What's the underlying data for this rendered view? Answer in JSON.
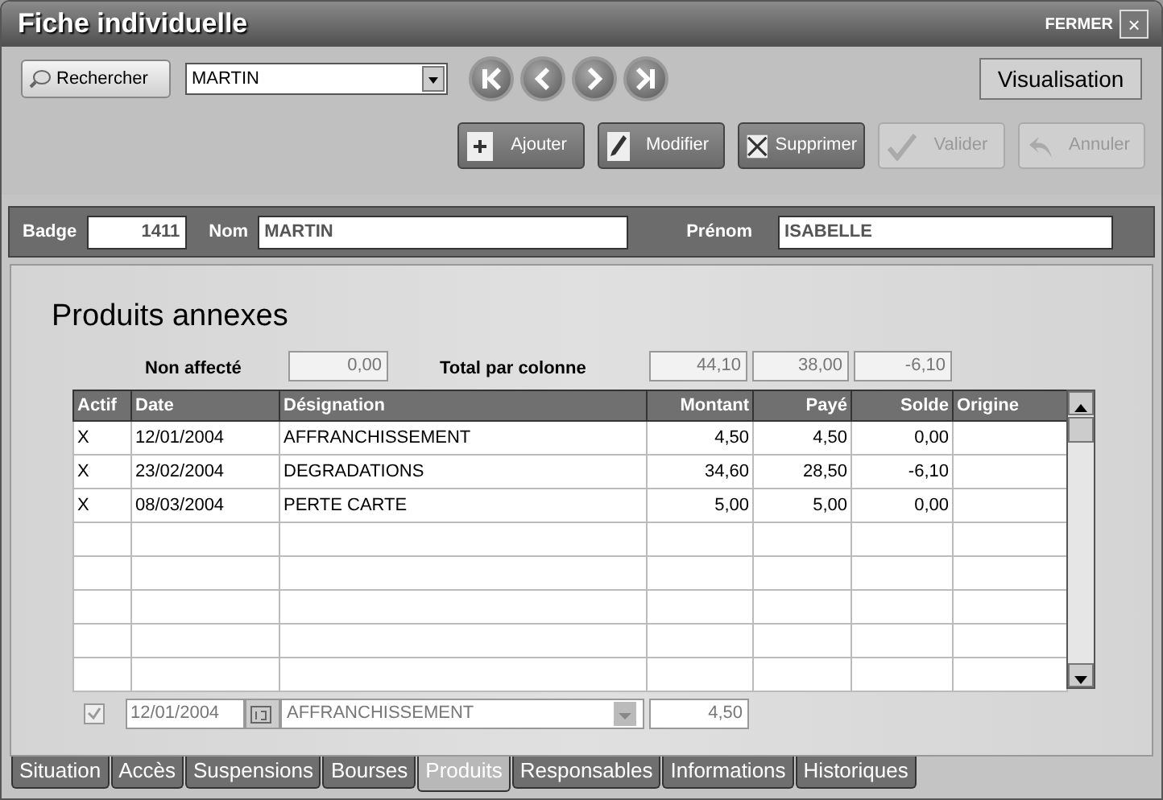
{
  "window": {
    "title": "Fiche individuelle",
    "close_label": "FERMER",
    "close_glyph": "×"
  },
  "toolbar": {
    "search_button": "Rechercher",
    "search_value": "MARTIN",
    "mode": "Visualisation",
    "actions": [
      {
        "label": "Ajouter",
        "kind": "add",
        "disabled": false
      },
      {
        "label": "Modifier",
        "kind": "edit",
        "disabled": false
      },
      {
        "label": "Supprimer",
        "kind": "delete",
        "disabled": false
      },
      {
        "label": "Valider",
        "kind": "check",
        "disabled": true
      },
      {
        "label": "Annuler",
        "kind": "undo",
        "disabled": true
      }
    ]
  },
  "identity": {
    "badge_label": "Badge",
    "badge": "1411",
    "nom_label": "Nom",
    "nom": "MARTIN",
    "prenom_label": "Prénom",
    "prenom": "ISABELLE"
  },
  "section_title": "Produits annexes",
  "totals": {
    "non_affecte_label": "Non affecté",
    "non_affecte": "0,00",
    "total_label": "Total par colonne",
    "values": [
      "44,10",
      "38,00",
      "-6,10"
    ]
  },
  "table": {
    "columns": [
      "Actif",
      "Date",
      "Désignation",
      "Montant",
      "Payé",
      "Solde",
      "Origine"
    ],
    "rows": [
      [
        "X",
        "12/01/2004",
        "AFFRANCHISSEMENT",
        "4,50",
        "4,50",
        "0,00",
        ""
      ],
      [
        "X",
        "23/02/2004",
        "DEGRADATIONS",
        "34,60",
        "28,50",
        "-6,10",
        ""
      ],
      [
        "X",
        "08/03/2004",
        "PERTE CARTE",
        "5,00",
        "5,00",
        "0,00",
        ""
      ]
    ]
  },
  "editor": {
    "checked": true,
    "date": "12/01/2004",
    "designation": "AFFRANCHISSEMENT",
    "montant": "4,50"
  },
  "tabs": [
    {
      "label": "Situation",
      "selected": false
    },
    {
      "label": "Accès",
      "selected": false
    },
    {
      "label": "Suspensions",
      "selected": false
    },
    {
      "label": "Bourses",
      "selected": false
    },
    {
      "label": "Produits",
      "selected": true
    },
    {
      "label": "Responsables",
      "selected": false
    },
    {
      "label": "Informations",
      "selected": false
    },
    {
      "label": "Historiques",
      "selected": false
    }
  ]
}
